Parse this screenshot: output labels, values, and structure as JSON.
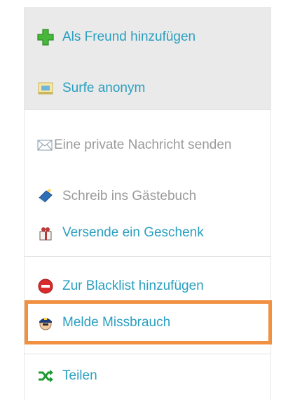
{
  "menu": {
    "add_friend": {
      "label": "Als Freund hinzufügen",
      "icon": "green-plus-icon"
    },
    "surf_anon": {
      "label": "Surfe anonym",
      "icon": "anonymous-card-icon"
    },
    "private_message": {
      "label": "Eine private Nachricht senden",
      "icon": "envelope-icon"
    },
    "guestbook": {
      "label": "Schreib ins Gästebuch",
      "icon": "book-pen-icon"
    },
    "gift": {
      "label": "Versende ein Geschenk",
      "icon": "gift-icon"
    },
    "blacklist": {
      "label": "Zur Blacklist hinzufügen",
      "icon": "red-minus-icon"
    },
    "report": {
      "label": "Melde Missbrauch",
      "icon": "police-officer-icon"
    },
    "share": {
      "label": "Teilen",
      "icon": "shuffle-arrows-icon"
    }
  },
  "colors": {
    "link": "#2a9fc0",
    "muted": "#9a9a9a",
    "highlight": "#f09040",
    "gray_bg": "#eaeaea"
  }
}
